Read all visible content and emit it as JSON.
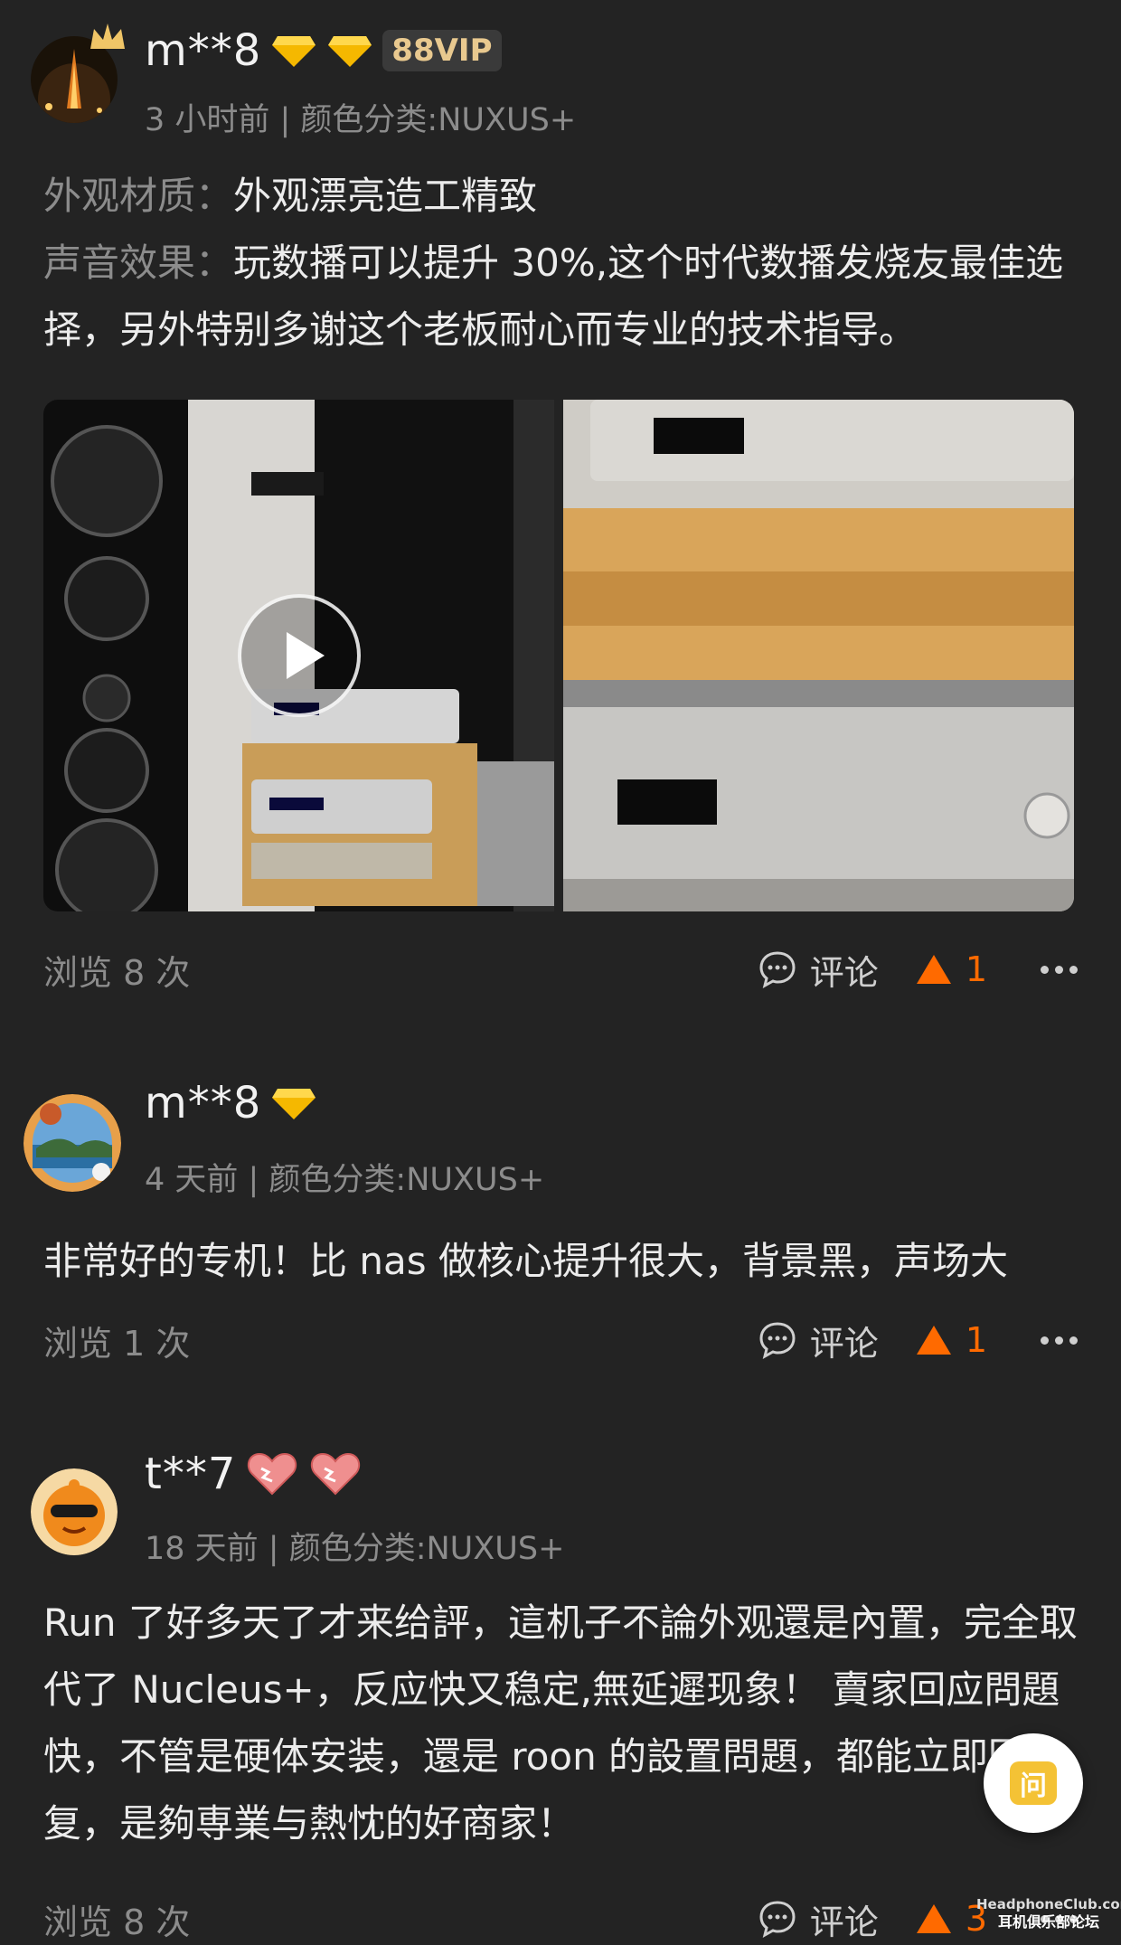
{
  "reviews": [
    {
      "username": "m**8",
      "vip_badge": "88VIP",
      "meta": "3 小时前 | 颜色分类:NUXUS+",
      "appearance_label": "外观材质：",
      "appearance_text": "外观漂亮造工精致",
      "sound_label": "声音效果：",
      "sound_text": "玩数播可以提升 30%,这个时代数播发烧友最佳选择，另外特别多谢这个老板耐心而专业的技术指导。",
      "views": "浏览 8 次",
      "comment_label": "评论",
      "likes": "1"
    },
    {
      "username": "m**8",
      "meta": "4 天前 | 颜色分类:NUXUS+",
      "text": "非常好的专机！比 nas 做核心提升很大，背景黑，声场大",
      "views": "浏览 1 次",
      "comment_label": "评论",
      "likes": "1"
    },
    {
      "username": "t**7",
      "meta": "18 天前 | 颜色分类:NUXUS+",
      "text": "Run 了好多天了才来给評，這机子不論外观還是內置，完全取代了 Nucleus+，反应快又稳定,無延遲现象！ 賣家回应問題快，不管是硬体安装，還是 roon 的設置問題，都能立即回复，是夠専業与熱忱的好商家！",
      "views": "浏览 8 次",
      "comment_label": "评论",
      "likes": "3"
    }
  ],
  "fab_label": "问",
  "watermark": {
    "site": "HeadphoneClub.com",
    "name": "耳机俱乐部论坛"
  },
  "colors": {
    "background": "#232323",
    "muted": "#8c8c8c",
    "like": "#ff6a00",
    "vip": "#e9c98f"
  }
}
